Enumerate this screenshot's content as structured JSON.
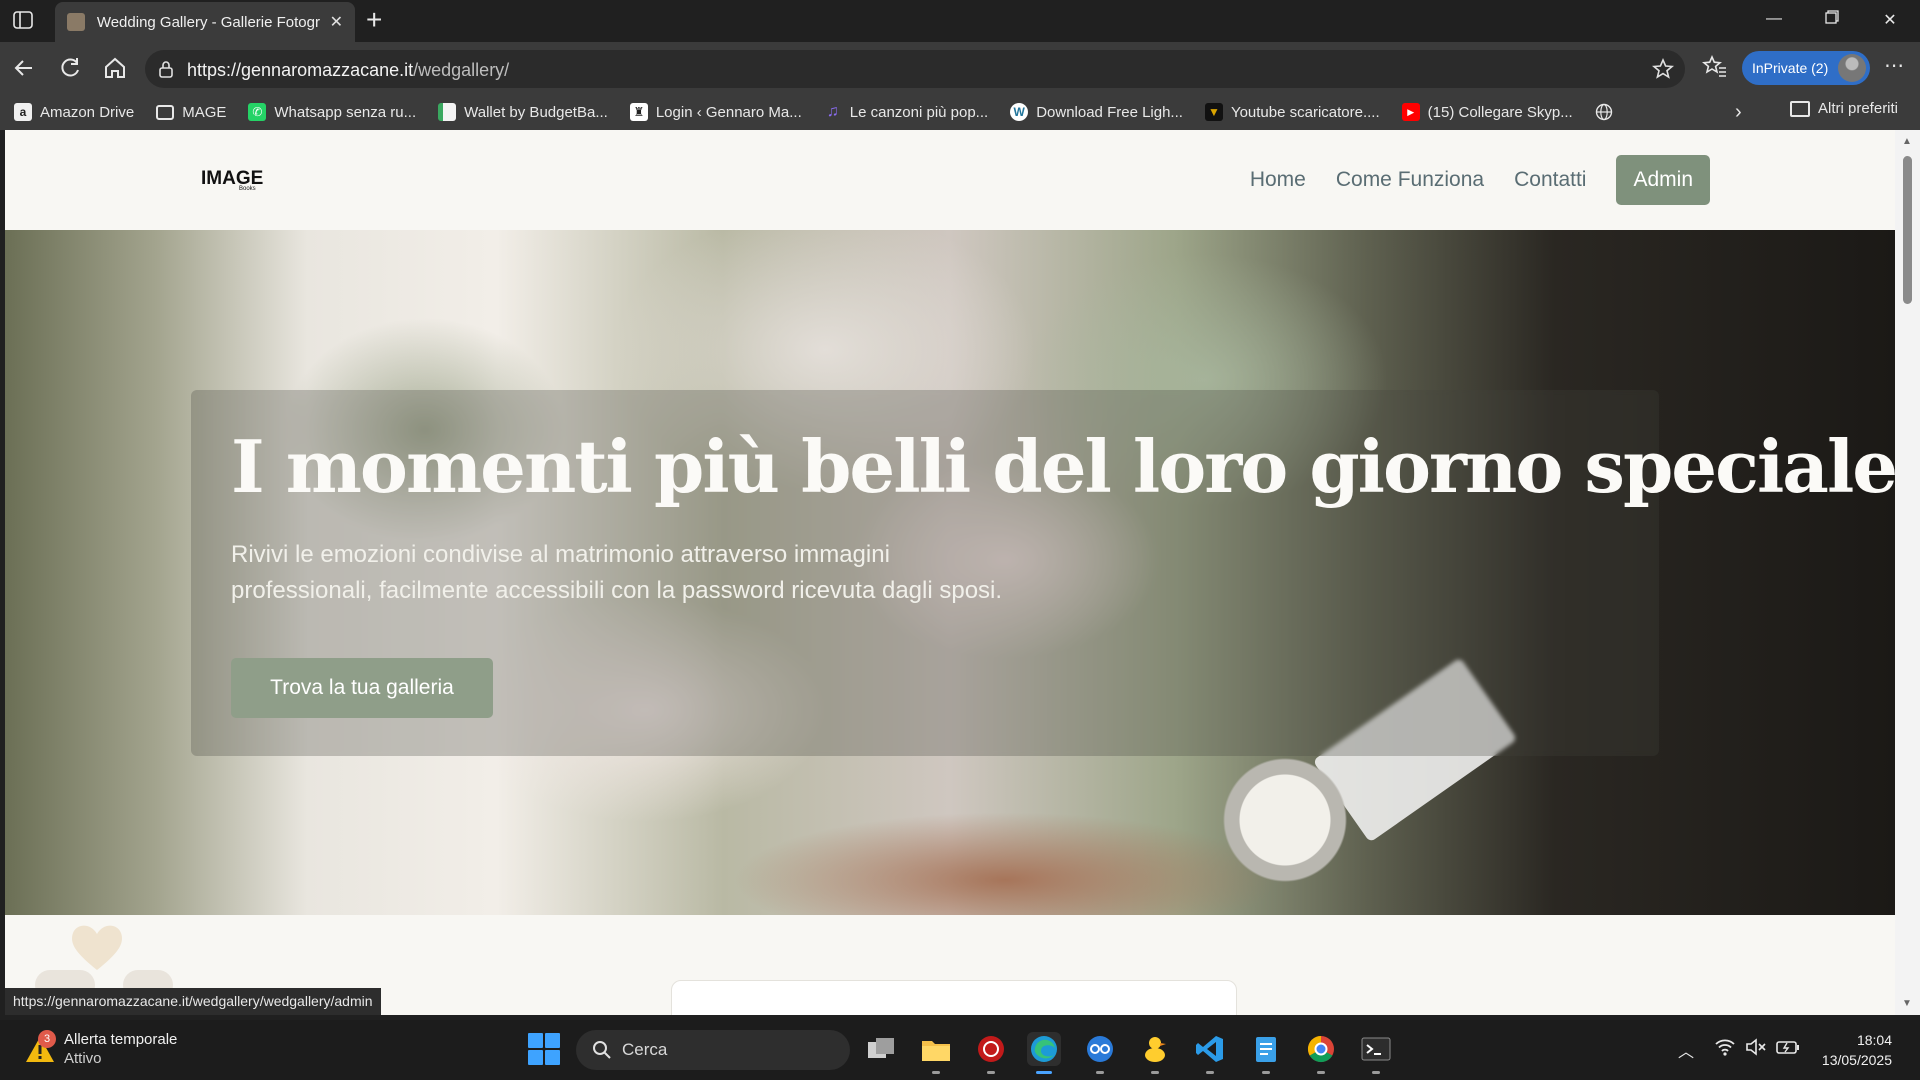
{
  "browser": {
    "tab_title": "Wedding Gallery - Gallerie Fotogr",
    "url_host": "https://gennaromazzacane.it",
    "url_path": "/wedgallery/",
    "inprivate_label": "InPrivate (2)",
    "more_menu": "⋯"
  },
  "bookmarks": [
    {
      "label": "Amazon Drive",
      "icon": "amazon-icon",
      "color": "#f0f0f0"
    },
    {
      "label": "MAGE",
      "icon": "folder-icon",
      "color": "#e8e8e8"
    },
    {
      "label": "Whatsapp senza ru...",
      "icon": "whatsapp-icon",
      "color": "#25d366"
    },
    {
      "label": "Wallet by BudgetBa...",
      "icon": "wallet-icon",
      "color": "#3aa860"
    },
    {
      "label": "Login ‹ Gennaro Ma...",
      "icon": "login-icon",
      "color": "#ffffff"
    },
    {
      "label": "Le canzoni più pop...",
      "icon": "music-icon",
      "color": "#8a6cf0"
    },
    {
      "label": "Download Free Ligh...",
      "icon": "wordpress-icon",
      "color": "#ffffff"
    },
    {
      "label": "Youtube scaricatore....",
      "icon": "downloader-icon",
      "color": "#d9a400"
    },
    {
      "label": "(15) Collegare Skyp...",
      "icon": "youtube-icon",
      "color": "#ff0000"
    }
  ],
  "bookmarks_other": "Altri preferiti",
  "site": {
    "logo": "IMAGE",
    "logo_sub": "Books",
    "nav": {
      "home": "Home",
      "how": "Come Funziona",
      "contacts": "Contatti",
      "admin": "Admin"
    },
    "hero": {
      "title": "I momenti più belli del loro giorno speciale",
      "subtitle_line1": "Rivivi le emozioni condivise al matrimonio attraverso immagini",
      "subtitle_line2": "professionali, facilmente accessibili con la password ricevuta dagli sposi.",
      "button": "Trova la tua galleria"
    },
    "accent_color": "#7f917c"
  },
  "status_bar_url": "https://gennaromazzacane.it/wedgallery/wedgallery/admin",
  "taskbar": {
    "weather_badge": "3",
    "weather_title": "Allerta temporale",
    "weather_status": "Attivo",
    "search_placeholder": "Cerca",
    "time": "18:04",
    "date": "13/05/2025"
  }
}
